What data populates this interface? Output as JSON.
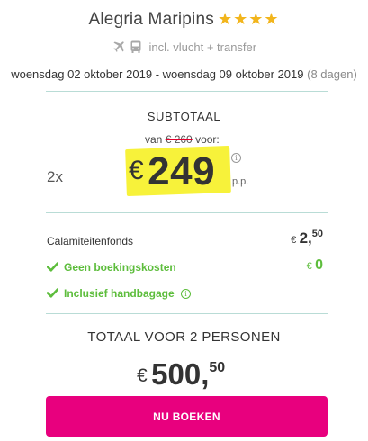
{
  "hotel": {
    "name": "Alegria Maripins",
    "stars": "★★★★"
  },
  "transport": {
    "text": "incl. vlucht + transfer",
    "icons": [
      "plane-icon",
      "bus-icon"
    ]
  },
  "dates": {
    "from": "woensdag 02 oktober 2019",
    "separator": "-",
    "to": "woensdag 09 oktober 2019",
    "duration": "(8 dagen)"
  },
  "subtotal": {
    "heading": "SUBTOTAAL",
    "was_prefix": "van",
    "was_price": "€ 260",
    "was_suffix": "voor:",
    "quantity": "2x",
    "currency": "€",
    "price": "249",
    "per_person": "p.p."
  },
  "costs": {
    "calamity_label": "Calamiteitenfonds",
    "calamity_currency": "€",
    "calamity_whole": "2,",
    "calamity_cents": "50",
    "booking_label": "Geen boekingskosten",
    "booking_currency": "€",
    "booking_value": "0",
    "baggage_label": "Inclusief handbagage"
  },
  "total": {
    "heading": "TOTAAL VOOR 2 PERSONEN",
    "currency": "€",
    "whole": "500,",
    "cents": "50"
  },
  "cta": {
    "label": "NU BOEKEN"
  },
  "colors": {
    "accent": "#e8007e",
    "highlight": "#f7f23a",
    "green": "#5dbd3c",
    "stars": "#f2b51c",
    "divider": "#b9dcd6"
  }
}
